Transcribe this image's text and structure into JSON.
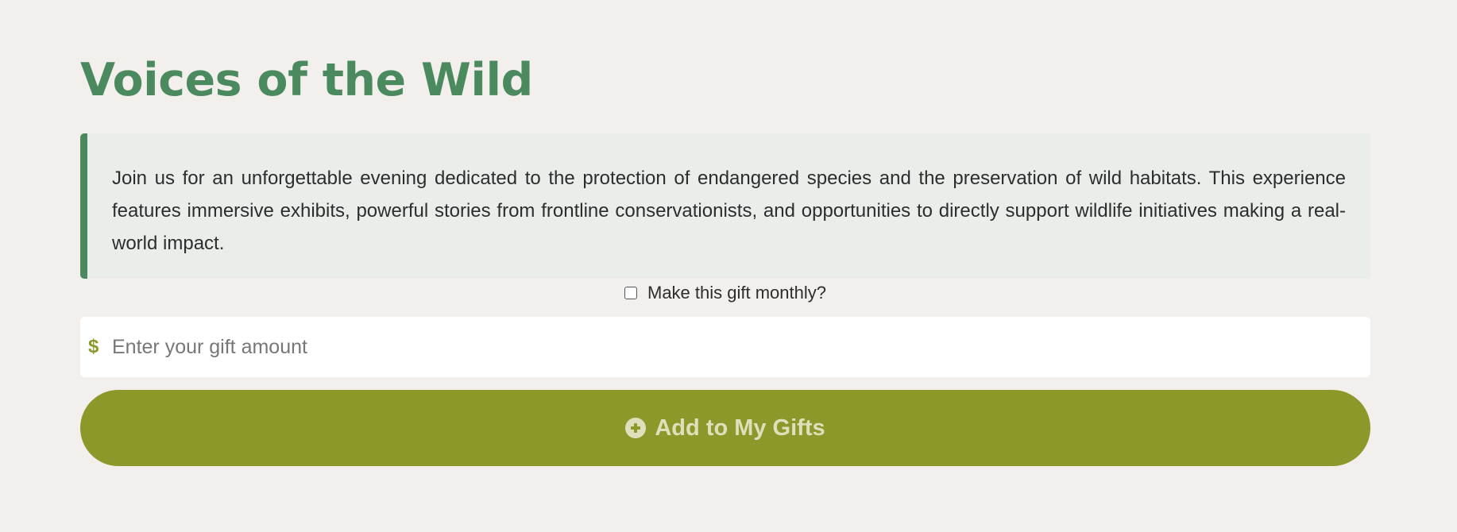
{
  "page": {
    "title": "Voices of the Wild",
    "description": "Join us for an unforgettable evening dedicated to the protection of endangered species and the preservation of wild habitats. This experience features immersive exhibits, powerful stories from frontline conservationists, and opportunities to directly support wildlife initiatives making a real-world impact."
  },
  "gift": {
    "monthly_label": "Make this gift monthly?",
    "monthly_checked": false,
    "currency_symbol": "$",
    "amount_value": "",
    "amount_placeholder": "Enter your gift amount",
    "add_button_label": "Add to My Gifts",
    "add_button_icon": "plus-circle-icon"
  },
  "colors": {
    "background": "#f2efec",
    "title_green": "#4b8a5e",
    "description_bg": "#eaeeeb",
    "accent_olive": "#8d982a",
    "button_text": "#dde0bb"
  }
}
